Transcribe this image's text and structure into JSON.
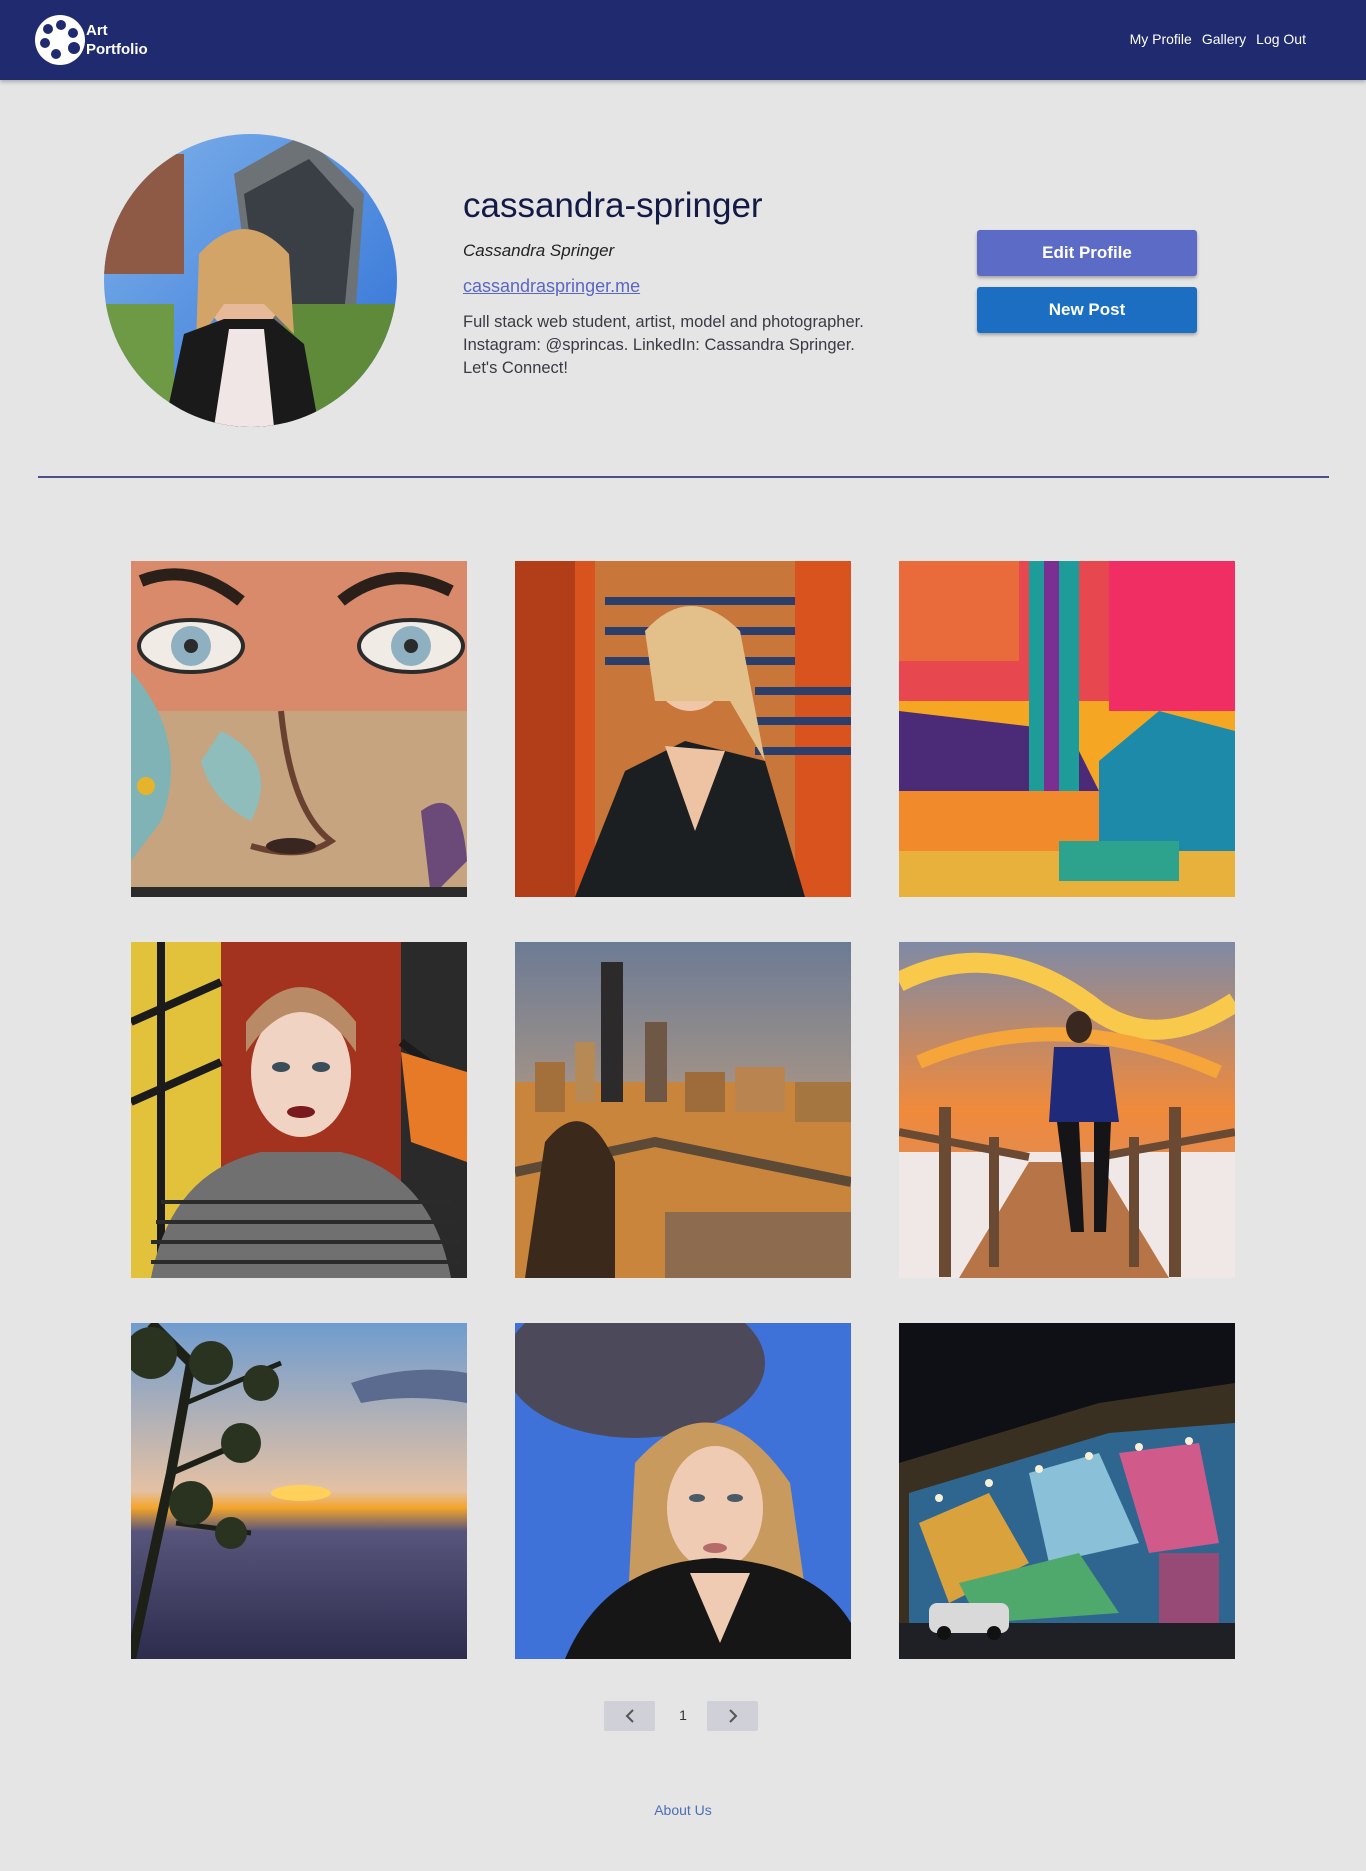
{
  "nav": {
    "brand_line1": "Art",
    "brand_line2": "Portfolio",
    "links": [
      "My Profile",
      "Gallery",
      "Log Out"
    ]
  },
  "profile": {
    "username": "cassandra-springer",
    "full_name": "Cassandra Springer",
    "website": "cassandraspringer.me",
    "bio": "Full stack web student, artist, model and photographer. Instagram: @sprincas. LinkedIn: Cassandra Springer. Let's Connect!",
    "edit_button": "Edit Profile",
    "new_post_button": "New Post"
  },
  "gallery": {
    "images": [
      "mural-face-photo",
      "portrait-egyptian-mural-photo",
      "abstract-painting-photo",
      "portrait-stained-glass-photo",
      "city-skyline-photo",
      "boardwalk-sunset-photo",
      "canyon-sunset-photo",
      "portrait-blue-wall-photo",
      "street-mural-night-photo"
    ]
  },
  "pagination": {
    "current_page": "1"
  },
  "footer": {
    "about_link": "About Us"
  },
  "colors": {
    "navbar": "#1f2b6e",
    "background": "#e5e5e5",
    "edit_button": "#5c6bc6",
    "new_post_button": "#1b6ec2",
    "link": "#5b67c0"
  }
}
